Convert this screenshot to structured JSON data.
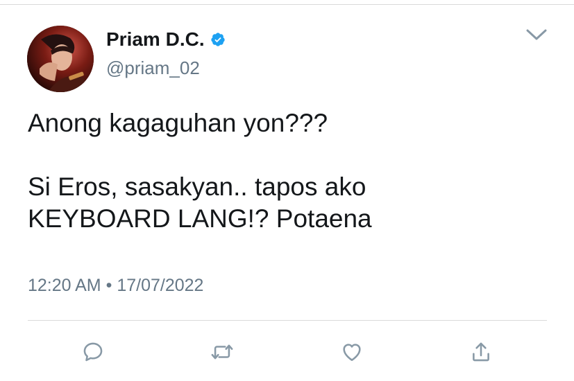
{
  "tweet": {
    "display_name": "Priam D.C.",
    "handle": "@priam_02",
    "verified": true,
    "text_lines": [
      "Anong kagaguhan yon???",
      "Si Eros, sasakyan.. tapos ako",
      "KEYBOARD LANG!? Potaena"
    ],
    "time": "12:20 AM",
    "separator": "•",
    "date": "17/07/2022"
  },
  "icons": {
    "verified": "verified-badge-icon",
    "menu": "chevron-down-icon",
    "reply": "reply-icon",
    "retweet": "retweet-icon",
    "like": "heart-icon",
    "share": "share-icon"
  },
  "colors": {
    "text": "#14171a",
    "secondary": "#657786",
    "verified": "#1da1f2",
    "icon": "#8899a6",
    "divider": "#d9d9d9"
  }
}
